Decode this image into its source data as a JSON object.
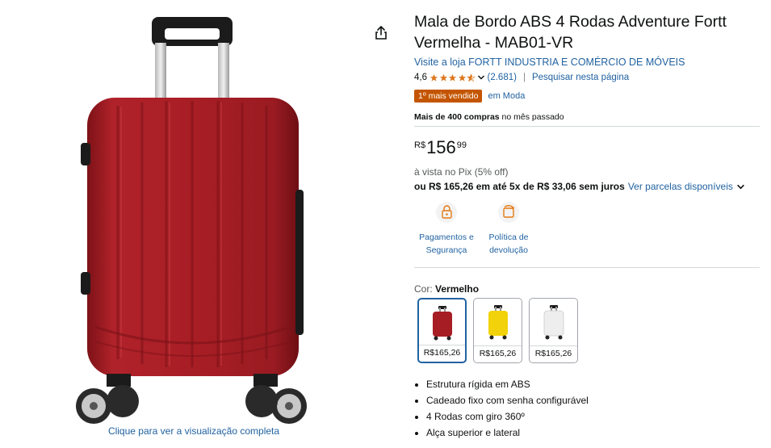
{
  "product": {
    "title": "Mala de Bordo ABS 4 Rodas Adventure Fortt Vermelha - MAB01-VR",
    "store_link": "Visite a loja FORTT INDUSTRIA E COMÉRCIO DE MÓVEIS",
    "rating": "4,6",
    "rating_count": "(2.681)",
    "search_page": "Pesquisar nesta página",
    "badge": "1º mais vendido",
    "badge_category": "em Moda",
    "purchases_bold": "Mais de 400 compras",
    "purchases_rest": " no mês passado",
    "price": {
      "currency": "R$",
      "whole": "156",
      "fraction": "99"
    },
    "pix_text": "à vista no Pix (5% off)",
    "installments": "ou R$ 165,26 em até 5x de R$ 33,06 sem juros",
    "installments_link": "Ver parcelas disponíveis",
    "features": [
      {
        "label": "Pagamentos e Segurança",
        "icon": "payment-lock-icon"
      },
      {
        "label": "Política de devolução",
        "icon": "return-policy-icon"
      }
    ],
    "color_label": "Cor:",
    "color_selected": "Vermelho",
    "swatches": [
      {
        "color": "#a61d24",
        "price": "R$165,26",
        "selected": true
      },
      {
        "color": "#f2d20a",
        "price": "R$165,26",
        "selected": false
      },
      {
        "color": "#eeeeee",
        "price": "R$165,26",
        "selected": false
      }
    ],
    "bullets": [
      "Estrutura rígida em ABS",
      "Cadeado fixo com senha configurável",
      "4 Rodas com giro 360º",
      "Alça superior e lateral"
    ]
  },
  "image": {
    "caption": "Clique para ver a visualização completa",
    "share_icon": "share-icon"
  },
  "colors": {
    "link": "#2162a1",
    "badge": "#c45500",
    "star": "#de7921",
    "suitcase": "#a61d24"
  }
}
